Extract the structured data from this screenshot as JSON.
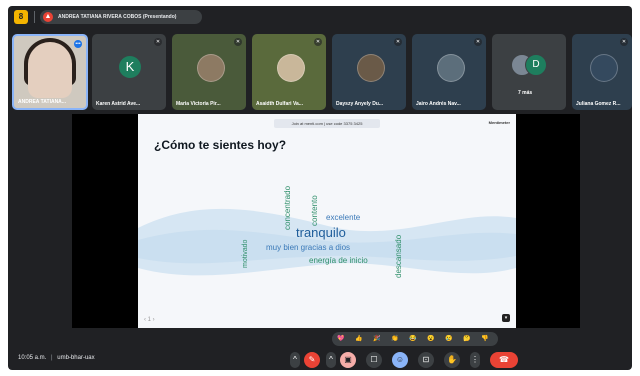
{
  "topbar": {
    "app_badge": "8",
    "presenter_label": "ANDREA TATIANA RIVERA COBOS (Presentando)",
    "present_icon": "present-icon"
  },
  "participants": [
    {
      "name": "ANDREA TATIANA...",
      "type": "self"
    },
    {
      "name": "Karen Astrid Ave...",
      "type": "initial",
      "initial": "K"
    },
    {
      "name": "Maria Victoria Pir...",
      "type": "photo"
    },
    {
      "name": "Asaidth Dulfari Va...",
      "type": "photo"
    },
    {
      "name": "Dayszy Anyely Du...",
      "type": "photo"
    },
    {
      "name": "Jairo Andrés Nav...",
      "type": "photo"
    },
    {
      "name": "7 más",
      "type": "more",
      "initial": "D"
    },
    {
      "name": "Juliana Gomez R...",
      "type": "photo"
    }
  ],
  "slide": {
    "join_text": "Join at menti.com | use code  3375 3425",
    "brand": "Mentimeter",
    "question": "¿Cómo te sientes hoy?",
    "nav": "‹  1  ›",
    "words": [
      {
        "text": "concentrado",
        "color": "#2f8f6a"
      },
      {
        "text": "contento",
        "color": "#2f8f6a"
      },
      {
        "text": "excelente",
        "color": "#3a79b8"
      },
      {
        "text": "tranquilo",
        "color": "#1f5d9a"
      },
      {
        "text": "muy bien gracias a dios",
        "color": "#3a79b8"
      },
      {
        "text": "energía de inicio",
        "color": "#2f8f6a"
      },
      {
        "text": "motivado",
        "color": "#2f8f6a"
      },
      {
        "text": "descansado",
        "color": "#2f8f6a"
      }
    ]
  },
  "reactions": [
    "💖",
    "👍",
    "🎉",
    "👏",
    "😂",
    "😮",
    "😢",
    "🤔",
    "👎"
  ],
  "bottombar": {
    "time": "10:05 a.m.",
    "meeting_code": "umb-bhar-uax",
    "separator": "|"
  },
  "colors": {
    "frame_bg": "#202124",
    "tile_bg": "#3c4043",
    "end_call": "#ea4335",
    "accent": "#8ab4f8"
  }
}
